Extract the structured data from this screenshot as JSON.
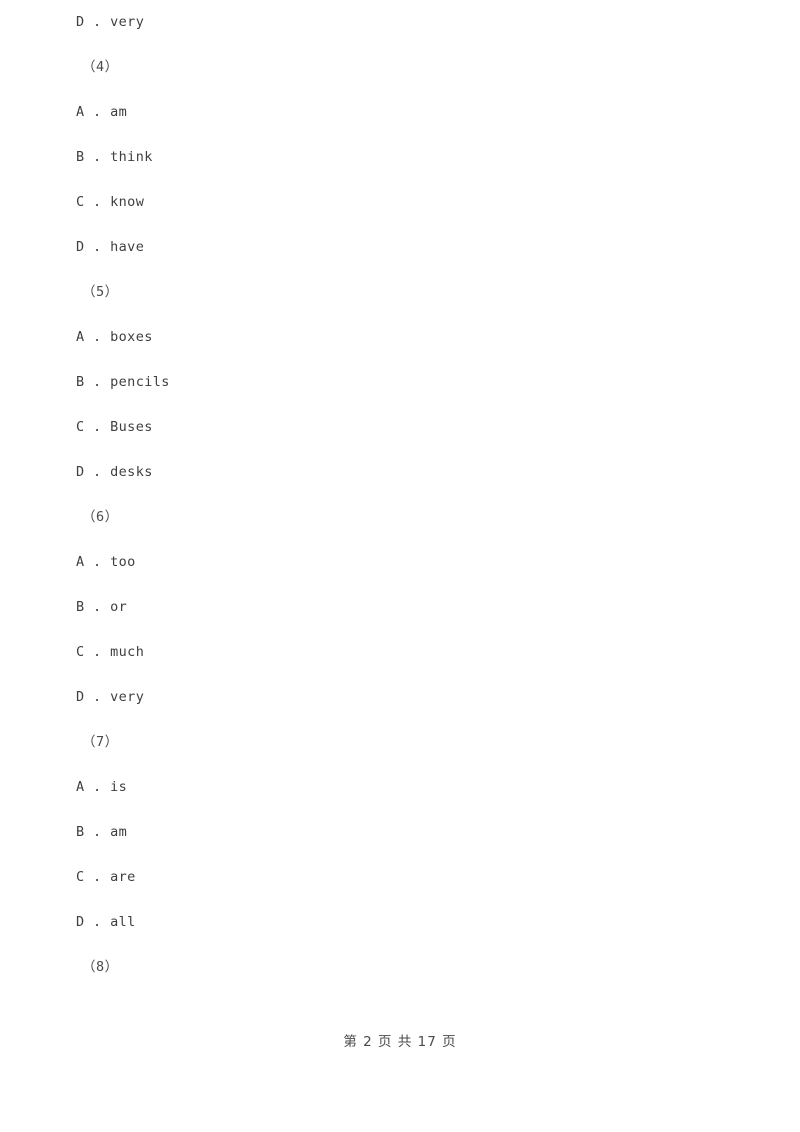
{
  "document": {
    "background_color": "#ffffff",
    "text_color": "#3f3f3f"
  },
  "blocks": [
    {
      "kind": "option",
      "text": "D . very"
    },
    {
      "kind": "question",
      "text": "（4）"
    },
    {
      "kind": "option",
      "text": "A . am"
    },
    {
      "kind": "option",
      "text": "B . think"
    },
    {
      "kind": "option",
      "text": "C . know"
    },
    {
      "kind": "option",
      "text": "D . have"
    },
    {
      "kind": "question",
      "text": "（5）"
    },
    {
      "kind": "option",
      "text": "A . boxes"
    },
    {
      "kind": "option",
      "text": "B . pencils"
    },
    {
      "kind": "option",
      "text": "C . Buses"
    },
    {
      "kind": "option",
      "text": "D . desks"
    },
    {
      "kind": "question",
      "text": "（6）"
    },
    {
      "kind": "option",
      "text": "A . too"
    },
    {
      "kind": "option",
      "text": "B . or"
    },
    {
      "kind": "option",
      "text": "C . much"
    },
    {
      "kind": "option",
      "text": "D . very"
    },
    {
      "kind": "question",
      "text": "（7）"
    },
    {
      "kind": "option",
      "text": "A . is"
    },
    {
      "kind": "option",
      "text": "B . am"
    },
    {
      "kind": "option",
      "text": "C . are"
    },
    {
      "kind": "option",
      "text": "D . all"
    },
    {
      "kind": "question",
      "text": "（8）"
    }
  ],
  "footer": {
    "text": "第 2 页 共 17 页",
    "page_number": "2",
    "total_pages": "17"
  }
}
